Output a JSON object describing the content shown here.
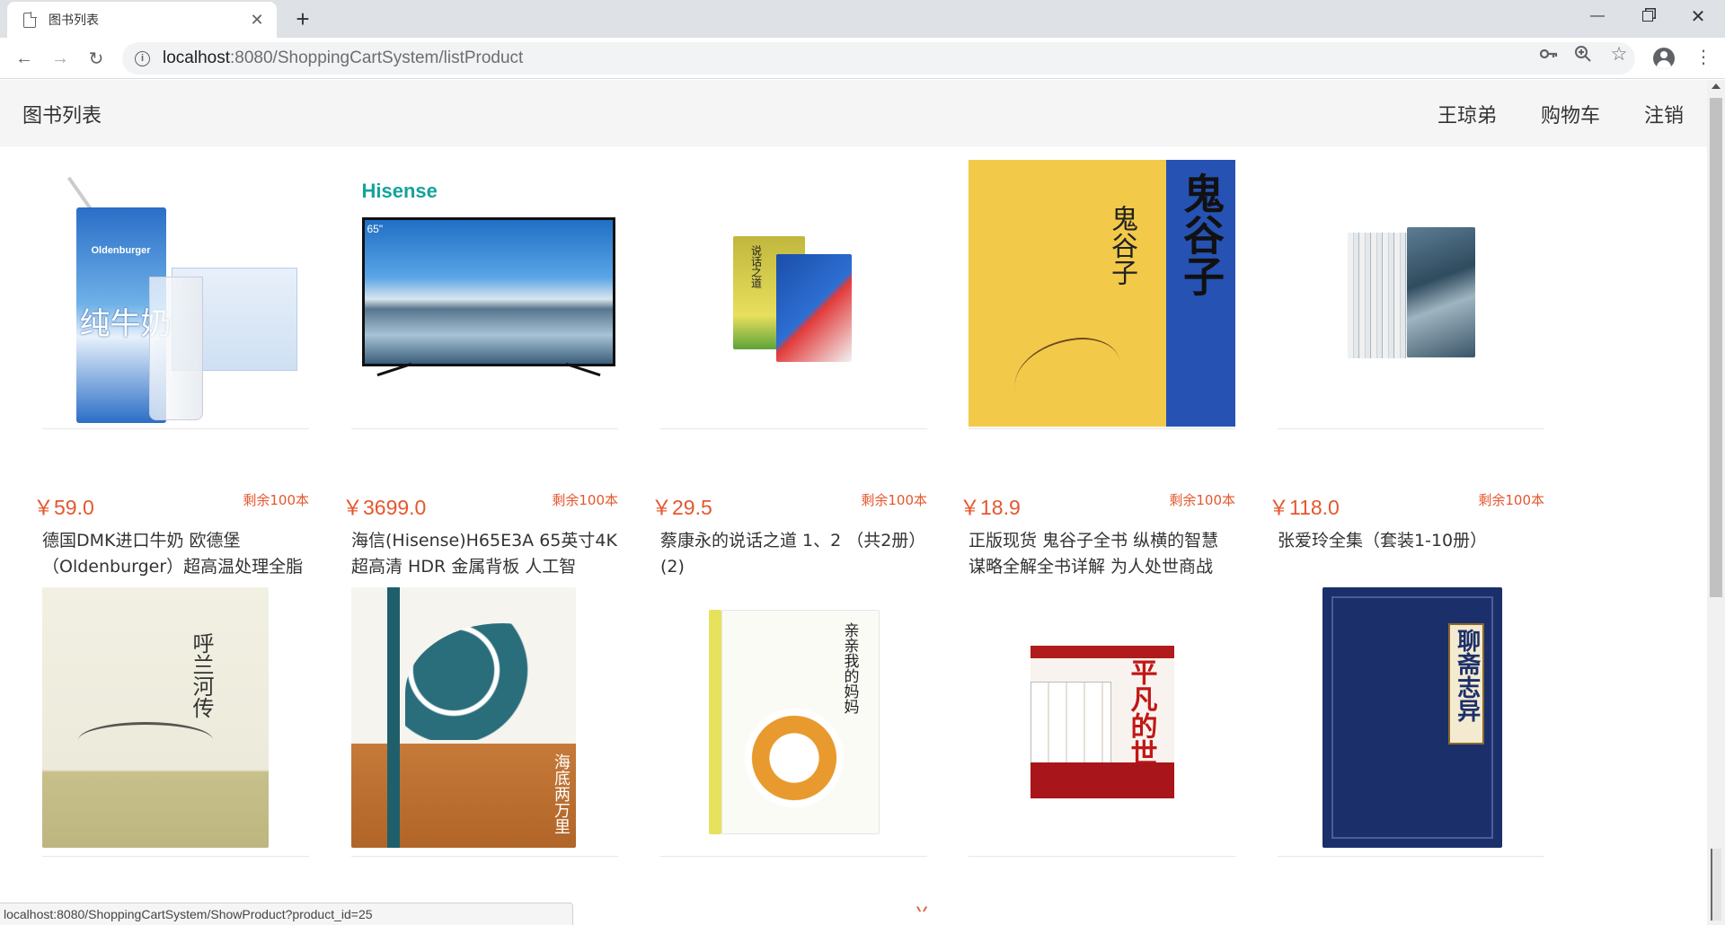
{
  "browser": {
    "tab_title": "图书列表",
    "new_tab": "+",
    "url_host": "localhost",
    "url_path": ":8080/ShoppingCartSystem/listProduct",
    "status_url": "localhost:8080/ShoppingCartSystem/ShowProduct?product_id=25"
  },
  "header": {
    "brand": "图书列表",
    "user": "王琼弟",
    "cart": "购物车",
    "logout": "注销"
  },
  "products": [
    {
      "price": "￥59.0",
      "stock": "剩余100本",
      "title": "德国DMK进口牛奶 欧德堡（Oldenburger）超高温处理全脂",
      "art_text": "纯牛奶",
      "art_brand": "Oldenburger"
    },
    {
      "price": "￥3699.0",
      "stock": "剩余100本",
      "title": "海信(Hisense)H65E3A 65英寸4K超高清 HDR 金属背板 人工智",
      "art_brand": "Hisense",
      "art_size": "65\""
    },
    {
      "price": "￥29.5",
      "stock": "剩余100本",
      "title": "蔡康永的说话之道 1、2 （共2册）(2)",
      "art_text": "说话之道"
    },
    {
      "price": "￥18.9",
      "stock": "剩余100本",
      "title": "正版现货 鬼谷子全书 纵横的智慧谋略全解全书详解 为人处世商战",
      "art_text": "鬼谷子"
    },
    {
      "price": "￥118.0",
      "stock": "剩余100本",
      "title": "张爱玲全集（套装1-10册）"
    },
    {
      "price": "",
      "stock": "",
      "title": "",
      "art_text": "呼兰河传"
    },
    {
      "price": "",
      "stock": "",
      "title": "",
      "art_text": "海底两万里"
    },
    {
      "price": "",
      "stock": "",
      "title": "",
      "art_text": "亲亲我的妈妈"
    },
    {
      "price": "",
      "stock": "",
      "title": "",
      "art_text": "平凡的世界"
    },
    {
      "price": "",
      "stock": "",
      "title": "",
      "art_text": "聊斋志异"
    }
  ]
}
